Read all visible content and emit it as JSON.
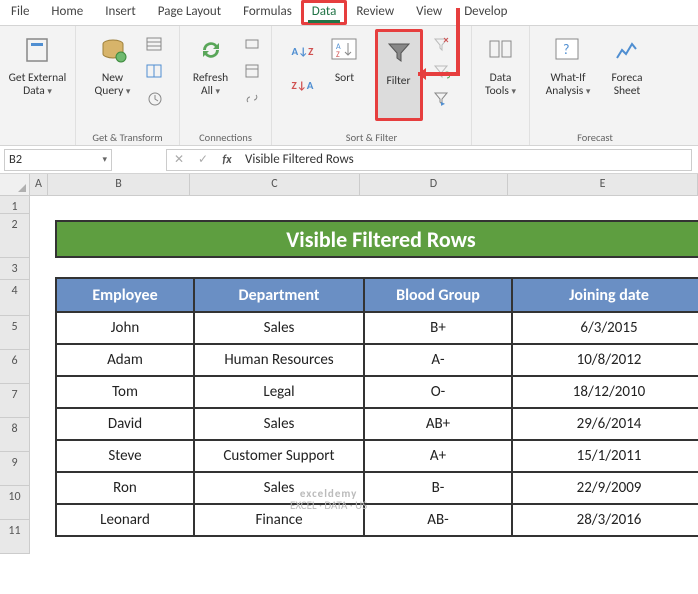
{
  "tabs": [
    "File",
    "Home",
    "Insert",
    "Page Layout",
    "Formulas",
    "Data",
    "Review",
    "View",
    "Develop"
  ],
  "active_tab": "Data",
  "ribbon": {
    "get_external": {
      "label": "Get External\nData"
    },
    "new_query": {
      "label": "New\nQuery"
    },
    "group_get_transform": "Get & Transform",
    "refresh": {
      "label": "Refresh\nAll"
    },
    "group_connections": "Connections",
    "sort": {
      "label": "Sort"
    },
    "filter": {
      "label": "Filter"
    },
    "group_sort_filter": "Sort & Filter",
    "data_tools": {
      "label": "Data\nTools"
    },
    "whatif": {
      "label": "What-If\nAnalysis"
    },
    "forecast": {
      "label": "Foreca\nSheet"
    },
    "group_forecast": "Forecast"
  },
  "namebox": "B2",
  "formula_value": "Visible Filtered Rows",
  "columns": [
    "A",
    "B",
    "C",
    "D",
    "E"
  ],
  "rows": [
    "1",
    "2",
    "3",
    "4",
    "5",
    "6",
    "7",
    "8",
    "9",
    "10",
    "11"
  ],
  "title": "Visible Filtered Rows",
  "headers": [
    "Employee",
    "Department",
    "Blood Group",
    "Joining date"
  ],
  "data": [
    {
      "emp": "John",
      "dept": "Sales",
      "bg": "B+",
      "jd": "6/3/2015"
    },
    {
      "emp": "Adam",
      "dept": "Human Resources",
      "bg": "A-",
      "jd": "10/8/2012"
    },
    {
      "emp": "Tom",
      "dept": "Legal",
      "bg": "O-",
      "jd": "18/12/2010"
    },
    {
      "emp": "David",
      "dept": "Sales",
      "bg": "AB+",
      "jd": "29/6/2014"
    },
    {
      "emp": "Steve",
      "dept": "Customer Support",
      "bg": "A+",
      "jd": "15/1/2011"
    },
    {
      "emp": "Ron",
      "dept": "Sales",
      "bg": "B-",
      "jd": "22/9/2009"
    },
    {
      "emp": "Leonard",
      "dept": "Finance",
      "bg": "AB-",
      "jd": "28/3/2016"
    }
  ],
  "watermark": {
    "line1": "exceldemy",
    "line2": "EXCEL · DATA · US"
  }
}
